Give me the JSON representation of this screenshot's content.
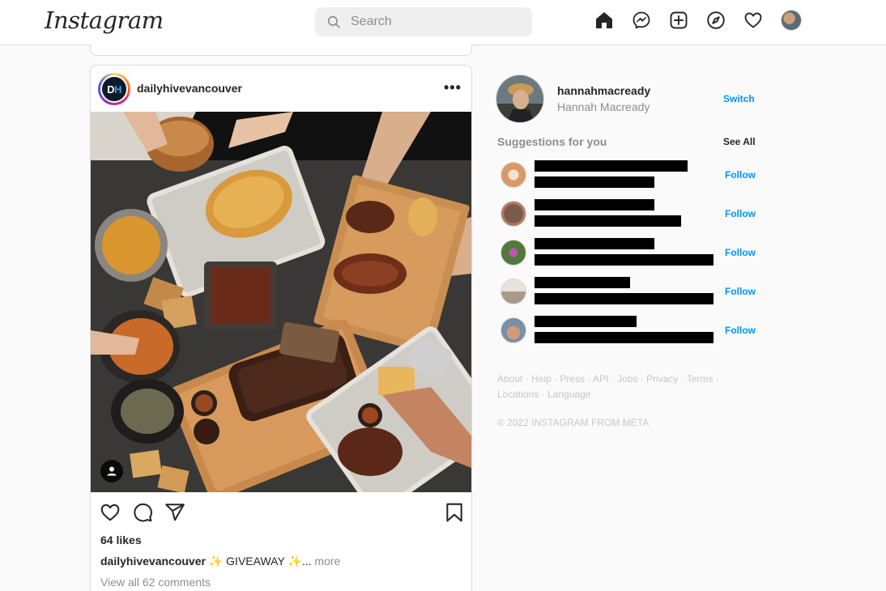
{
  "header": {
    "logo": "Instagram",
    "search_placeholder": "Search",
    "icons": [
      "home-icon",
      "messenger-icon",
      "new-post-icon",
      "explore-icon",
      "activity-heart-icon",
      "profile-avatar"
    ]
  },
  "post": {
    "avatar_initials_d": "D",
    "avatar_initials_h": "H",
    "username": "dailyhivevancouver",
    "more": "•••",
    "likes": "64 likes",
    "caption_user": "dailyhivevancouver",
    "caption_sparkle_1": "✨",
    "caption_text": " GIVEAWAY ",
    "caption_sparkle_2": "✨",
    "caption_ellipsis": "... ",
    "caption_more": "more",
    "comments_link": "View all 62 comments"
  },
  "sidebar": {
    "username": "hannahmacready",
    "full_name": "Hannah Macready",
    "switch_label": "Switch",
    "suggestions_heading": "Suggestions for you",
    "see_all_label": "See All",
    "suggestions": [
      {
        "follow_label": "Follow"
      },
      {
        "follow_label": "Follow"
      },
      {
        "follow_label": "Follow"
      },
      {
        "follow_label": "Follow"
      },
      {
        "follow_label": "Follow"
      }
    ],
    "footer_links": "About · Help · Press · API · Jobs · Privacy · Terms · Locations · Language",
    "copyright": "© 2022 INSTAGRAM FROM META"
  },
  "colors": {
    "link_blue": "#0095f6",
    "border": "#dbdbdb",
    "secondary_text": "#8e8e8e",
    "background": "#fafafa"
  }
}
